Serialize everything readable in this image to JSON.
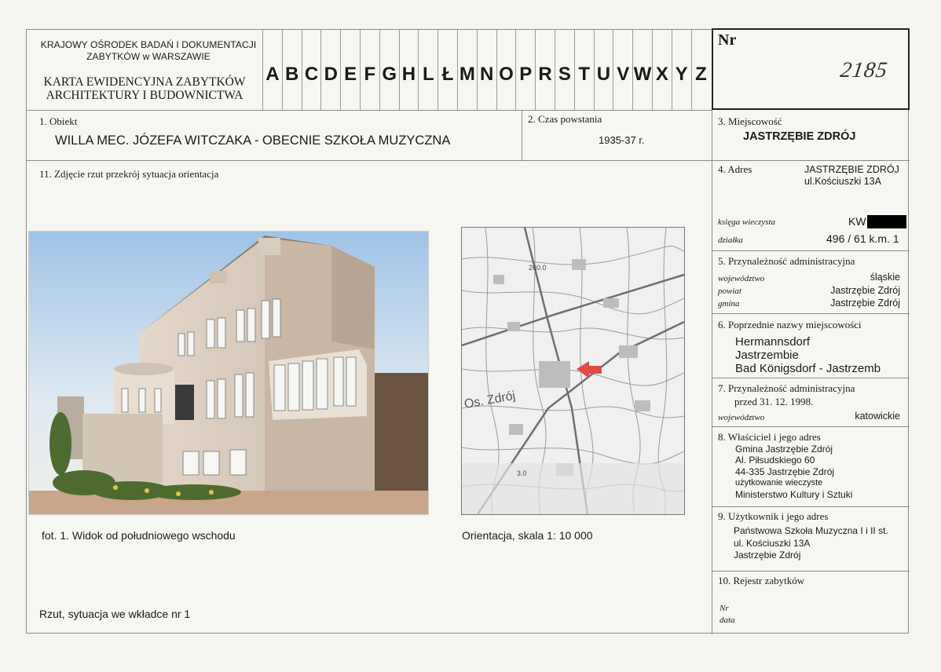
{
  "header": {
    "institution_line1": "KRAJOWY OŚRODEK BADAŃ I DOKUMENTACJI",
    "institution_line2": "ZABYTKÓW w WARSZAWIE",
    "card_title_line1": "KARTA EWIDENCYJNA ZABYTKÓW",
    "card_title_line2": "ARCHITEKTURY I BUDOWNICTWA",
    "letters": [
      "A",
      "B",
      "C",
      "D",
      "E",
      "F",
      "G",
      "H",
      "L",
      "Ł",
      "M",
      "N",
      "O",
      "P",
      "R",
      "S",
      "T",
      "U",
      "V",
      "W",
      "X",
      "Y",
      "Z"
    ],
    "nr_label": "Nr",
    "nr_value": "2185"
  },
  "section1": {
    "label": "1.  Obiekt",
    "value": "WILLA MEC. JÓZEFA WITCZAKA - OBECNIE SZKOŁA MUZYCZNA"
  },
  "section2": {
    "label": "2.   Czas  powstania",
    "value": "1935-37 r."
  },
  "section3": {
    "label": "3.  Miejscowość",
    "value": "JASTRZĘBIE ZDRÓJ"
  },
  "section11": {
    "label": "11.  Zdjęcie rzut przekrój sytuacja orientacja"
  },
  "section4": {
    "label": "4.  Adres",
    "address_line1": "JASTRZĘBIE ZDRÓJ",
    "address_line2": "ul.Kościuszki 13A",
    "ksiega_label": "księga wieczysta",
    "ksiega_value": "KW",
    "dzialka_label": "działka",
    "dzialka_value": "496 / 61 k.m. 1"
  },
  "section5": {
    "label": "5.  Przynależność administracyjna",
    "wojewodztwo_label": "województwo",
    "wojewodztwo_value": "śląskie",
    "powiat_label": "powiat",
    "powiat_value": "Jastrzębie Zdrój",
    "gmina_label": "gmina",
    "gmina_value": "Jastrzębie Zdrój"
  },
  "section6": {
    "label": "6.  Poprzednie nazwy miejscowości",
    "names": [
      "Hermannsdorf",
      "Jastrzembie",
      "Bad Königsdorf - Jastrzemb"
    ]
  },
  "section7": {
    "label_line1": "7.  Przynależność administracyjna",
    "label_line2": "przed  31. 12. 1998.",
    "wojewodztwo_label": "województwo",
    "wojewodztwo_value": "katowickie"
  },
  "section8": {
    "label": "8.  Właściciel i jego adres",
    "lines": [
      "Gmina Jastrzębie Zdrój",
      "Al. Piłsudskiego 60",
      "44-335 Jastrzębie Zdrój",
      "użytkowanie  wieczyste",
      "Ministerstwo Kultury i Sztuki"
    ]
  },
  "section9": {
    "label": "9.  Użytkownik i jego adres",
    "lines": [
      "Państwowa Szkoła Muzyczna I i II st.",
      "ul. Kościuszki 13A",
      "Jastrzębie Zdrój"
    ]
  },
  "section10": {
    "label": "10.  Rejestr zabytków",
    "nr_label": "Nr",
    "data_label": "data"
  },
  "captions": {
    "photo": "fot. 1. Widok od południowego wschodu",
    "map": "Orientacja, skala 1: 10 000",
    "plan": "Rzut, sytuacja we wkładce nr 1"
  },
  "map_labels": {
    "district": "Os. Zdrój",
    "height": "260.0",
    "scale_mark": "3.0"
  },
  "colors": {
    "arrow": "#e04a4a",
    "sky": "#a9c9e8",
    "facade": "#ddd1c4"
  }
}
